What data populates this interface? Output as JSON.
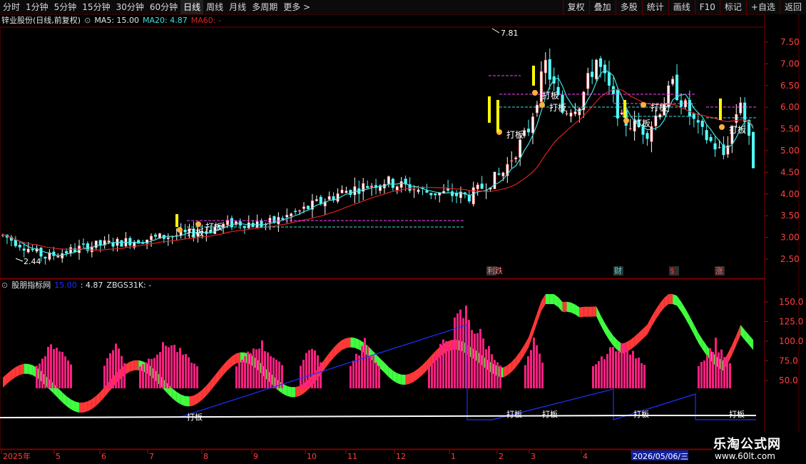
{
  "toolbar": {
    "periods": [
      "分时",
      "1分钟",
      "5分钟",
      "15分钟",
      "30分钟",
      "60分钟",
      "日线",
      "周线",
      "月线",
      "多周期",
      "更多 >"
    ],
    "active_period": "日线",
    "right_buttons": [
      "复权",
      "叠加",
      "多股",
      "统计",
      "画线",
      "F10",
      "标记",
      "+自选",
      "返回"
    ]
  },
  "main_chart": {
    "title": "锌业股份(日线,前复权)",
    "ma5_label": "MA5: 15.00",
    "ma20_label": "MA20: 4.87",
    "ma60_label": "MA60: -",
    "price_ticks": [
      "7.50",
      "7.00",
      "6.50",
      "6.00",
      "5.50",
      "5.00",
      "4.50",
      "4.00",
      "3.50",
      "3.00",
      "2.50"
    ],
    "high_marker": "7.81",
    "low_marker": "2.44",
    "signal_label": "打板",
    "event_tags": [
      "利跌",
      "财",
      "$",
      "涨"
    ],
    "colors": {
      "up": "#ff3232",
      "down": "#54ffff",
      "ma_red": "#e02020",
      "ma_cyan": "#40e0e0",
      "signal": "#ffff00"
    }
  },
  "indicator": {
    "title": "股朋指标网",
    "v1": "15.00",
    "v2": ": 4.87",
    "v3": "ZBGS31K: -",
    "ticks": [
      "150.0",
      "125.0",
      "100.0",
      "75.0",
      "50.0"
    ]
  },
  "time_axis": {
    "labels": [
      "2025年",
      "5",
      "6",
      "7",
      "8",
      "9",
      "10",
      "11",
      "12",
      "1",
      "2",
      "3",
      "4",
      "2026/05/06/三"
    ]
  },
  "watermark": {
    "title": "乐淘公式网",
    "url": "www.60lt.com"
  }
}
